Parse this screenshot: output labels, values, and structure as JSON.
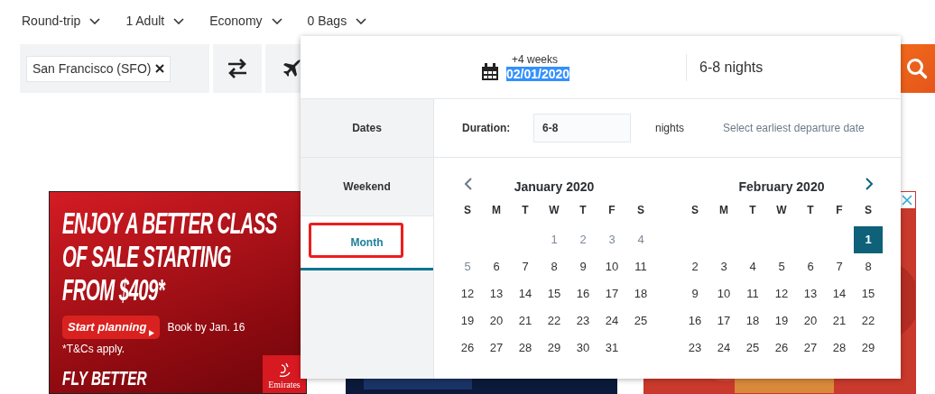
{
  "trip_options": [
    {
      "label": "Round-trip"
    },
    {
      "label": "1 Adult"
    },
    {
      "label": "Economy"
    },
    {
      "label": "0 Bags"
    }
  ],
  "search": {
    "origin": "San Francisco (SFO)"
  },
  "date_picker": {
    "offset": "+4 weeks",
    "date": "02/01/2020",
    "duration_summary": "6-8 nights",
    "tabs": [
      {
        "label": "Dates",
        "selected": false
      },
      {
        "label": "Weekend",
        "selected": false
      },
      {
        "label": "Month",
        "selected": true,
        "highlighted": true
      }
    ],
    "duration": {
      "label": "Duration:",
      "value": "6-8",
      "unit": "nights",
      "hint": "Select earliest departure date"
    },
    "months": [
      {
        "title": "January 2020",
        "weekdays": [
          "S",
          "M",
          "T",
          "W",
          "T",
          "F",
          "S"
        ],
        "weeks": [
          [
            {
              "kind": "empty"
            },
            {
              "kind": "empty"
            },
            {
              "kind": "empty"
            },
            {
              "day": "1",
              "disabled": true,
              "selected": false
            },
            {
              "day": "2",
              "disabled": true,
              "selected": false
            },
            {
              "day": "3",
              "disabled": true,
              "selected": false
            },
            {
              "day": "4",
              "disabled": true,
              "selected": false
            }
          ],
          [
            {
              "day": "5",
              "disabled": true,
              "selected": false
            },
            {
              "day": "6",
              "disabled": false,
              "selected": false
            },
            {
              "day": "7",
              "disabled": false,
              "selected": false
            },
            {
              "day": "8",
              "disabled": false,
              "selected": false
            },
            {
              "day": "9",
              "disabled": false,
              "selected": false
            },
            {
              "day": "10",
              "disabled": false,
              "selected": false
            },
            {
              "day": "11",
              "disabled": false,
              "selected": false
            }
          ],
          [
            {
              "day": "12",
              "disabled": false,
              "selected": false
            },
            {
              "day": "13",
              "disabled": false,
              "selected": false
            },
            {
              "day": "14",
              "disabled": false,
              "selected": false
            },
            {
              "day": "15",
              "disabled": false,
              "selected": false
            },
            {
              "day": "16",
              "disabled": false,
              "selected": false
            },
            {
              "day": "17",
              "disabled": false,
              "selected": false
            },
            {
              "day": "18",
              "disabled": false,
              "selected": false
            }
          ],
          [
            {
              "day": "19",
              "disabled": false,
              "selected": false
            },
            {
              "day": "20",
              "disabled": false,
              "selected": false
            },
            {
              "day": "21",
              "disabled": false,
              "selected": false
            },
            {
              "day": "22",
              "disabled": false,
              "selected": false
            },
            {
              "day": "23",
              "disabled": false,
              "selected": false
            },
            {
              "day": "24",
              "disabled": false,
              "selected": false
            },
            {
              "day": "25",
              "disabled": false,
              "selected": false
            }
          ],
          [
            {
              "day": "26",
              "disabled": false,
              "selected": false
            },
            {
              "day": "27",
              "disabled": false,
              "selected": false
            },
            {
              "day": "28",
              "disabled": false,
              "selected": false
            },
            {
              "day": "29",
              "disabled": false,
              "selected": false
            },
            {
              "day": "30",
              "disabled": false,
              "selected": false
            },
            {
              "day": "31",
              "disabled": false,
              "selected": false
            },
            {
              "kind": "empty"
            }
          ]
        ]
      },
      {
        "title": "February 2020",
        "weekdays": [
          "S",
          "M",
          "T",
          "W",
          "T",
          "F",
          "S"
        ],
        "weeks": [
          [
            {
              "kind": "empty"
            },
            {
              "kind": "empty"
            },
            {
              "kind": "empty"
            },
            {
              "kind": "empty"
            },
            {
              "kind": "empty"
            },
            {
              "kind": "empty"
            },
            {
              "day": "1",
              "disabled": false,
              "selected": true
            }
          ],
          [
            {
              "day": "2",
              "disabled": false,
              "selected": false
            },
            {
              "day": "3",
              "disabled": false,
              "selected": false
            },
            {
              "day": "4",
              "disabled": false,
              "selected": false
            },
            {
              "day": "5",
              "disabled": false,
              "selected": false
            },
            {
              "day": "6",
              "disabled": false,
              "selected": false
            },
            {
              "day": "7",
              "disabled": false,
              "selected": false
            },
            {
              "day": "8",
              "disabled": false,
              "selected": false
            }
          ],
          [
            {
              "day": "9",
              "disabled": false,
              "selected": false
            },
            {
              "day": "10",
              "disabled": false,
              "selected": false
            },
            {
              "day": "11",
              "disabled": false,
              "selected": false
            },
            {
              "day": "12",
              "disabled": false,
              "selected": false
            },
            {
              "day": "13",
              "disabled": false,
              "selected": false
            },
            {
              "day": "14",
              "disabled": false,
              "selected": false
            },
            {
              "day": "15",
              "disabled": false,
              "selected": false
            }
          ],
          [
            {
              "day": "16",
              "disabled": false,
              "selected": false
            },
            {
              "day": "17",
              "disabled": false,
              "selected": false
            },
            {
              "day": "18",
              "disabled": false,
              "selected": false
            },
            {
              "day": "19",
              "disabled": false,
              "selected": false
            },
            {
              "day": "20",
              "disabled": false,
              "selected": false
            },
            {
              "day": "21",
              "disabled": false,
              "selected": false
            },
            {
              "day": "22",
              "disabled": false,
              "selected": false
            }
          ],
          [
            {
              "day": "23",
              "disabled": false,
              "selected": false
            },
            {
              "day": "24",
              "disabled": false,
              "selected": false
            },
            {
              "day": "25",
              "disabled": false,
              "selected": false
            },
            {
              "day": "26",
              "disabled": false,
              "selected": false
            },
            {
              "day": "27",
              "disabled": false,
              "selected": false
            },
            {
              "day": "28",
              "disabled": false,
              "selected": false
            },
            {
              "day": "29",
              "disabled": false,
              "selected": false
            }
          ]
        ]
      }
    ]
  },
  "ads": [
    {
      "kind": "promo",
      "headline_lines": [
        "ENJOY A BETTER CLASS",
        "OF SALE STARTING",
        "FROM $409*"
      ],
      "cta": "Start planning",
      "deadline": "Book by Jan. 16",
      "terms": "*T&Cs apply.",
      "tagline": "FLY BETTER",
      "brand": "Emirates"
    },
    {
      "kind": "picture"
    },
    {
      "kind": "picture",
      "closable": true
    }
  ]
}
